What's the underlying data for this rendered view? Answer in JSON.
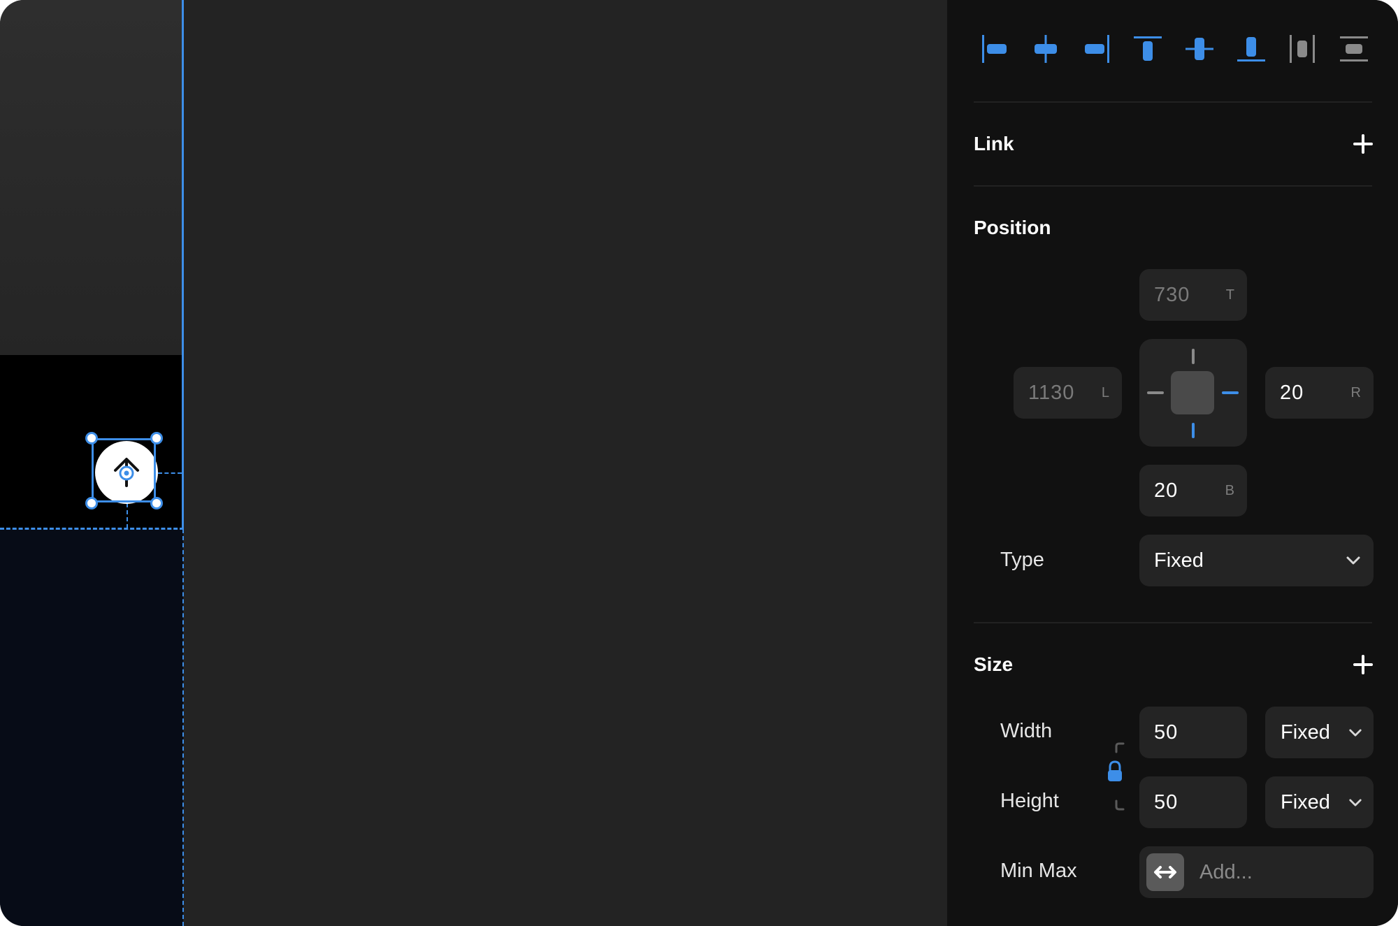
{
  "colors": {
    "accent": "#3d8ee8",
    "panel_bg": "#111111",
    "field_bg": "#242424",
    "canvas_bg": "#232323"
  },
  "canvas": {
    "selected_element_icon": "up-arrow-target-icon"
  },
  "toolbar": {
    "align_buttons": [
      "align-left-icon",
      "align-horizontal-center-icon",
      "align-right-icon",
      "align-top-icon",
      "align-vertical-center-icon",
      "align-bottom-icon",
      "distribute-horizontal-icon",
      "distribute-vertical-icon"
    ]
  },
  "link": {
    "title": "Link",
    "add_icon": "plus-icon"
  },
  "position": {
    "title": "Position",
    "top": {
      "value": "730",
      "side": "T"
    },
    "left": {
      "value": "1130",
      "side": "L"
    },
    "right": {
      "value": "20",
      "side": "R"
    },
    "bottom": {
      "value": "20",
      "side": "B"
    },
    "type_label": "Type",
    "type_value": "Fixed"
  },
  "size": {
    "title": "Size",
    "add_icon": "plus-icon",
    "width_label": "Width",
    "width_value": "50",
    "width_mode": "Fixed",
    "height_label": "Height",
    "height_value": "50",
    "height_mode": "Fixed",
    "aspect_lock": "lock-icon",
    "minmax_label": "Min Max",
    "minmax_placeholder": "Add...",
    "minmax_icon": "horizontal-arrows-icon"
  }
}
